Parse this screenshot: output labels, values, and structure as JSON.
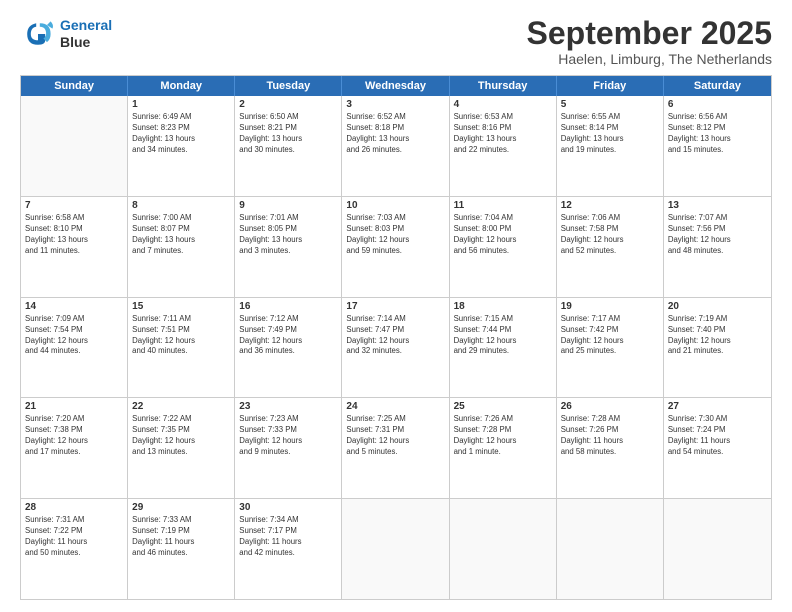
{
  "logo": {
    "line1": "General",
    "line2": "Blue"
  },
  "title": "September 2025",
  "location": "Haelen, Limburg, The Netherlands",
  "weekdays": [
    "Sunday",
    "Monday",
    "Tuesday",
    "Wednesday",
    "Thursday",
    "Friday",
    "Saturday"
  ],
  "weeks": [
    [
      {
        "day": "",
        "info": ""
      },
      {
        "day": "1",
        "info": "Sunrise: 6:49 AM\nSunset: 8:23 PM\nDaylight: 13 hours\nand 34 minutes."
      },
      {
        "day": "2",
        "info": "Sunrise: 6:50 AM\nSunset: 8:21 PM\nDaylight: 13 hours\nand 30 minutes."
      },
      {
        "day": "3",
        "info": "Sunrise: 6:52 AM\nSunset: 8:18 PM\nDaylight: 13 hours\nand 26 minutes."
      },
      {
        "day": "4",
        "info": "Sunrise: 6:53 AM\nSunset: 8:16 PM\nDaylight: 13 hours\nand 22 minutes."
      },
      {
        "day": "5",
        "info": "Sunrise: 6:55 AM\nSunset: 8:14 PM\nDaylight: 13 hours\nand 19 minutes."
      },
      {
        "day": "6",
        "info": "Sunrise: 6:56 AM\nSunset: 8:12 PM\nDaylight: 13 hours\nand 15 minutes."
      }
    ],
    [
      {
        "day": "7",
        "info": "Sunrise: 6:58 AM\nSunset: 8:10 PM\nDaylight: 13 hours\nand 11 minutes."
      },
      {
        "day": "8",
        "info": "Sunrise: 7:00 AM\nSunset: 8:07 PM\nDaylight: 13 hours\nand 7 minutes."
      },
      {
        "day": "9",
        "info": "Sunrise: 7:01 AM\nSunset: 8:05 PM\nDaylight: 13 hours\nand 3 minutes."
      },
      {
        "day": "10",
        "info": "Sunrise: 7:03 AM\nSunset: 8:03 PM\nDaylight: 12 hours\nand 59 minutes."
      },
      {
        "day": "11",
        "info": "Sunrise: 7:04 AM\nSunset: 8:00 PM\nDaylight: 12 hours\nand 56 minutes."
      },
      {
        "day": "12",
        "info": "Sunrise: 7:06 AM\nSunset: 7:58 PM\nDaylight: 12 hours\nand 52 minutes."
      },
      {
        "day": "13",
        "info": "Sunrise: 7:07 AM\nSunset: 7:56 PM\nDaylight: 12 hours\nand 48 minutes."
      }
    ],
    [
      {
        "day": "14",
        "info": "Sunrise: 7:09 AM\nSunset: 7:54 PM\nDaylight: 12 hours\nand 44 minutes."
      },
      {
        "day": "15",
        "info": "Sunrise: 7:11 AM\nSunset: 7:51 PM\nDaylight: 12 hours\nand 40 minutes."
      },
      {
        "day": "16",
        "info": "Sunrise: 7:12 AM\nSunset: 7:49 PM\nDaylight: 12 hours\nand 36 minutes."
      },
      {
        "day": "17",
        "info": "Sunrise: 7:14 AM\nSunset: 7:47 PM\nDaylight: 12 hours\nand 32 minutes."
      },
      {
        "day": "18",
        "info": "Sunrise: 7:15 AM\nSunset: 7:44 PM\nDaylight: 12 hours\nand 29 minutes."
      },
      {
        "day": "19",
        "info": "Sunrise: 7:17 AM\nSunset: 7:42 PM\nDaylight: 12 hours\nand 25 minutes."
      },
      {
        "day": "20",
        "info": "Sunrise: 7:19 AM\nSunset: 7:40 PM\nDaylight: 12 hours\nand 21 minutes."
      }
    ],
    [
      {
        "day": "21",
        "info": "Sunrise: 7:20 AM\nSunset: 7:38 PM\nDaylight: 12 hours\nand 17 minutes."
      },
      {
        "day": "22",
        "info": "Sunrise: 7:22 AM\nSunset: 7:35 PM\nDaylight: 12 hours\nand 13 minutes."
      },
      {
        "day": "23",
        "info": "Sunrise: 7:23 AM\nSunset: 7:33 PM\nDaylight: 12 hours\nand 9 minutes."
      },
      {
        "day": "24",
        "info": "Sunrise: 7:25 AM\nSunset: 7:31 PM\nDaylight: 12 hours\nand 5 minutes."
      },
      {
        "day": "25",
        "info": "Sunrise: 7:26 AM\nSunset: 7:28 PM\nDaylight: 12 hours\nand 1 minute."
      },
      {
        "day": "26",
        "info": "Sunrise: 7:28 AM\nSunset: 7:26 PM\nDaylight: 11 hours\nand 58 minutes."
      },
      {
        "day": "27",
        "info": "Sunrise: 7:30 AM\nSunset: 7:24 PM\nDaylight: 11 hours\nand 54 minutes."
      }
    ],
    [
      {
        "day": "28",
        "info": "Sunrise: 7:31 AM\nSunset: 7:22 PM\nDaylight: 11 hours\nand 50 minutes."
      },
      {
        "day": "29",
        "info": "Sunrise: 7:33 AM\nSunset: 7:19 PM\nDaylight: 11 hours\nand 46 minutes."
      },
      {
        "day": "30",
        "info": "Sunrise: 7:34 AM\nSunset: 7:17 PM\nDaylight: 11 hours\nand 42 minutes."
      },
      {
        "day": "",
        "info": ""
      },
      {
        "day": "",
        "info": ""
      },
      {
        "day": "",
        "info": ""
      },
      {
        "day": "",
        "info": ""
      }
    ]
  ]
}
